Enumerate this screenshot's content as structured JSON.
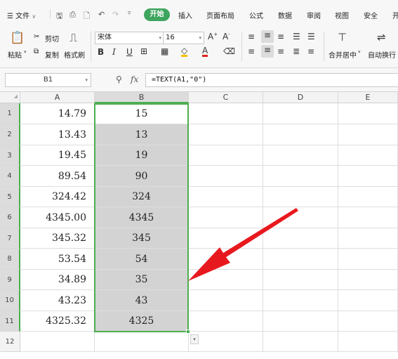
{
  "menu": {
    "file": "文件",
    "tabs": [
      "开始",
      "插入",
      "页面布局",
      "公式",
      "数据",
      "审阅",
      "视图",
      "安全",
      "开"
    ]
  },
  "toolbar": {
    "paste": "粘贴",
    "cut": "剪切",
    "copy": "复制",
    "format_painter": "格式刷",
    "font_name": "宋体",
    "font_size": "16",
    "merge_center": "合并居中",
    "auto_wrap": "自动换行",
    "bold": "B",
    "italic": "I",
    "underline": "U"
  },
  "formula_bar": {
    "name_box": "B1",
    "fx": "fx",
    "formula": "=TEXT(A1,\"0\")"
  },
  "grid": {
    "columns": [
      "A",
      "B",
      "C",
      "D",
      "E"
    ],
    "rows": [
      {
        "num": "1",
        "a": "14.79",
        "b": "15"
      },
      {
        "num": "2",
        "a": "13.43",
        "b": "13"
      },
      {
        "num": "3",
        "a": "19.45",
        "b": "19"
      },
      {
        "num": "4",
        "a": "89.54",
        "b": "90"
      },
      {
        "num": "5",
        "a": "324.42",
        "b": "324"
      },
      {
        "num": "6",
        "a": "4345.00",
        "b": "4345"
      },
      {
        "num": "7",
        "a": "345.32",
        "b": "345"
      },
      {
        "num": "8",
        "a": "53.54",
        "b": "54"
      },
      {
        "num": "9",
        "a": "34.89",
        "b": "35"
      },
      {
        "num": "10",
        "a": "43.23",
        "b": "43"
      },
      {
        "num": "11",
        "a": "4325.32",
        "b": "4325"
      },
      {
        "num": "12",
        "a": "",
        "b": ""
      }
    ]
  },
  "colors": {
    "accent_green": "#3da55d",
    "selection_border": "#4caf50",
    "selection_fill": "#d3d3d3",
    "arrow_red": "#e8191e"
  }
}
